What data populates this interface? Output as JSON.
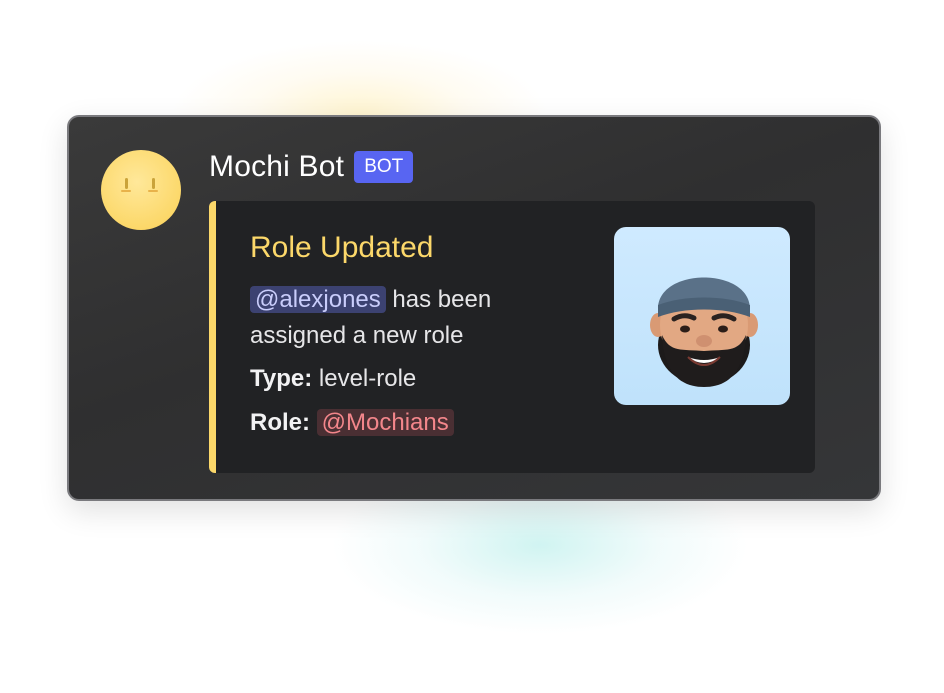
{
  "message": {
    "author_name": "Mochi Bot",
    "author_badge": "BOT",
    "avatar": "mochi-bot-avatar"
  },
  "embed": {
    "accent_color": "#fcd86a",
    "title": "Role Updated",
    "description_mention": "@alexjones",
    "description_rest": " has been assigned a new role",
    "fields": [
      {
        "key": "Type:",
        "value": "level-role"
      },
      {
        "key": "Role:",
        "value": "@Mochians"
      }
    ],
    "thumbnail": "bearded-man-memoji"
  },
  "colors": {
    "badge": "#5865f2",
    "user_mention_bg": "#3c4271",
    "role_mention_bg": "#4a2f33",
    "role_mention_text": "#f3868b"
  }
}
